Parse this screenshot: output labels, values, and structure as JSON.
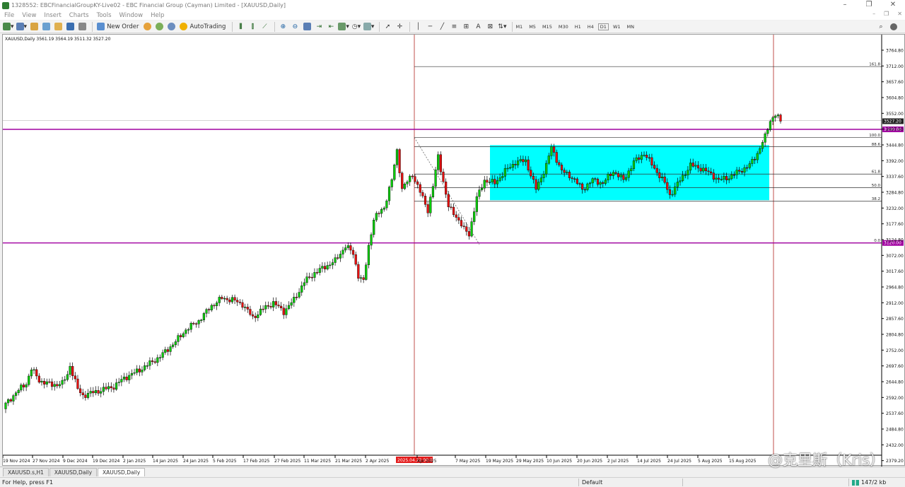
{
  "window": {
    "title": "1328552: EBCFinancialGroupKY-Live02 - EBC Financial Group (Cayman) Limited - [XAUUSD,Daily]",
    "controls": [
      "–",
      "❐",
      "✕"
    ]
  },
  "menu": {
    "items": [
      "File",
      "View",
      "Insert",
      "Charts",
      "Tools",
      "Window",
      "Help"
    ],
    "mdi_controls": [
      "–",
      "❐",
      "✕"
    ]
  },
  "toolbar": {
    "new_order_label": "New Order",
    "autotrading_label": "AutoTrading",
    "timeframes": [
      "M1",
      "M5",
      "M15",
      "M30",
      "H1",
      "H4",
      "D1",
      "W1",
      "MN"
    ],
    "active_timeframe": "D1"
  },
  "chart": {
    "info": "XAUUSD,Daily  3561.19 3564.19 3511.32 3527.20",
    "price_labels": [
      "3764.80",
      "3712.00",
      "3657.60",
      "3604.80",
      "3552.00",
      "3497.60",
      "3444.80",
      "3392.00",
      "3337.60",
      "3284.80",
      "3232.00",
      "3177.60",
      "3124.80",
      "3072.00",
      "3017.60",
      "2964.80",
      "2912.00",
      "2857.60",
      "2804.80",
      "2752.00",
      "2697.60",
      "2644.80",
      "2592.00",
      "2537.60",
      "2484.80",
      "2432.00",
      "2379.20"
    ],
    "date_labels": [
      "19 Nov 2024",
      "27 Nov 2024",
      "9 Dec 2024",
      "19 Dec 2024",
      "2 Jan 2025",
      "14 Jan 2025",
      "24 Jan 2025",
      "5 Feb 2025",
      "17 Feb 2025",
      "27 Feb 2025",
      "11 Mar 2025",
      "21 Mar 2025",
      "2 Apr 2025",
      "Apr 2025",
      "7 May 2025",
      "19 May 2025",
      "29 May 2025",
      "10 Jun 2025",
      "20 Jun 2025",
      "2 Jul 2025",
      "14 Jul 2025",
      "24 Jul 2025",
      "5 Aug 2025",
      "15 Aug 2025"
    ],
    "vline_date_label": "2025.04.22 00:00",
    "current_price": "3527.20",
    "hline_top_label": "3500.00",
    "hline_bottom_label": "3120.00",
    "level_labels": {
      "top": "161.8",
      "l100": "100.0",
      "l88": "88.6",
      "l61": "61.8",
      "l50": "50.0",
      "l38": "38.2",
      "l0": "0.0"
    },
    "colors": {
      "bull": "#0acd0a",
      "bear": "#e81010",
      "fib_zone": "#00ffff",
      "hline": "#a000a0",
      "vline": "#c0504d"
    }
  },
  "tabs": [
    "XAUUSD.s,H1",
    "XAUUSD,Daily",
    "XAUUSD,Daily"
  ],
  "active_tab": 2,
  "status": {
    "help": "For Help, press F1",
    "profile": "Default",
    "traffic": "147/2 kb"
  },
  "watermark": "@克里斯（Kris）"
}
